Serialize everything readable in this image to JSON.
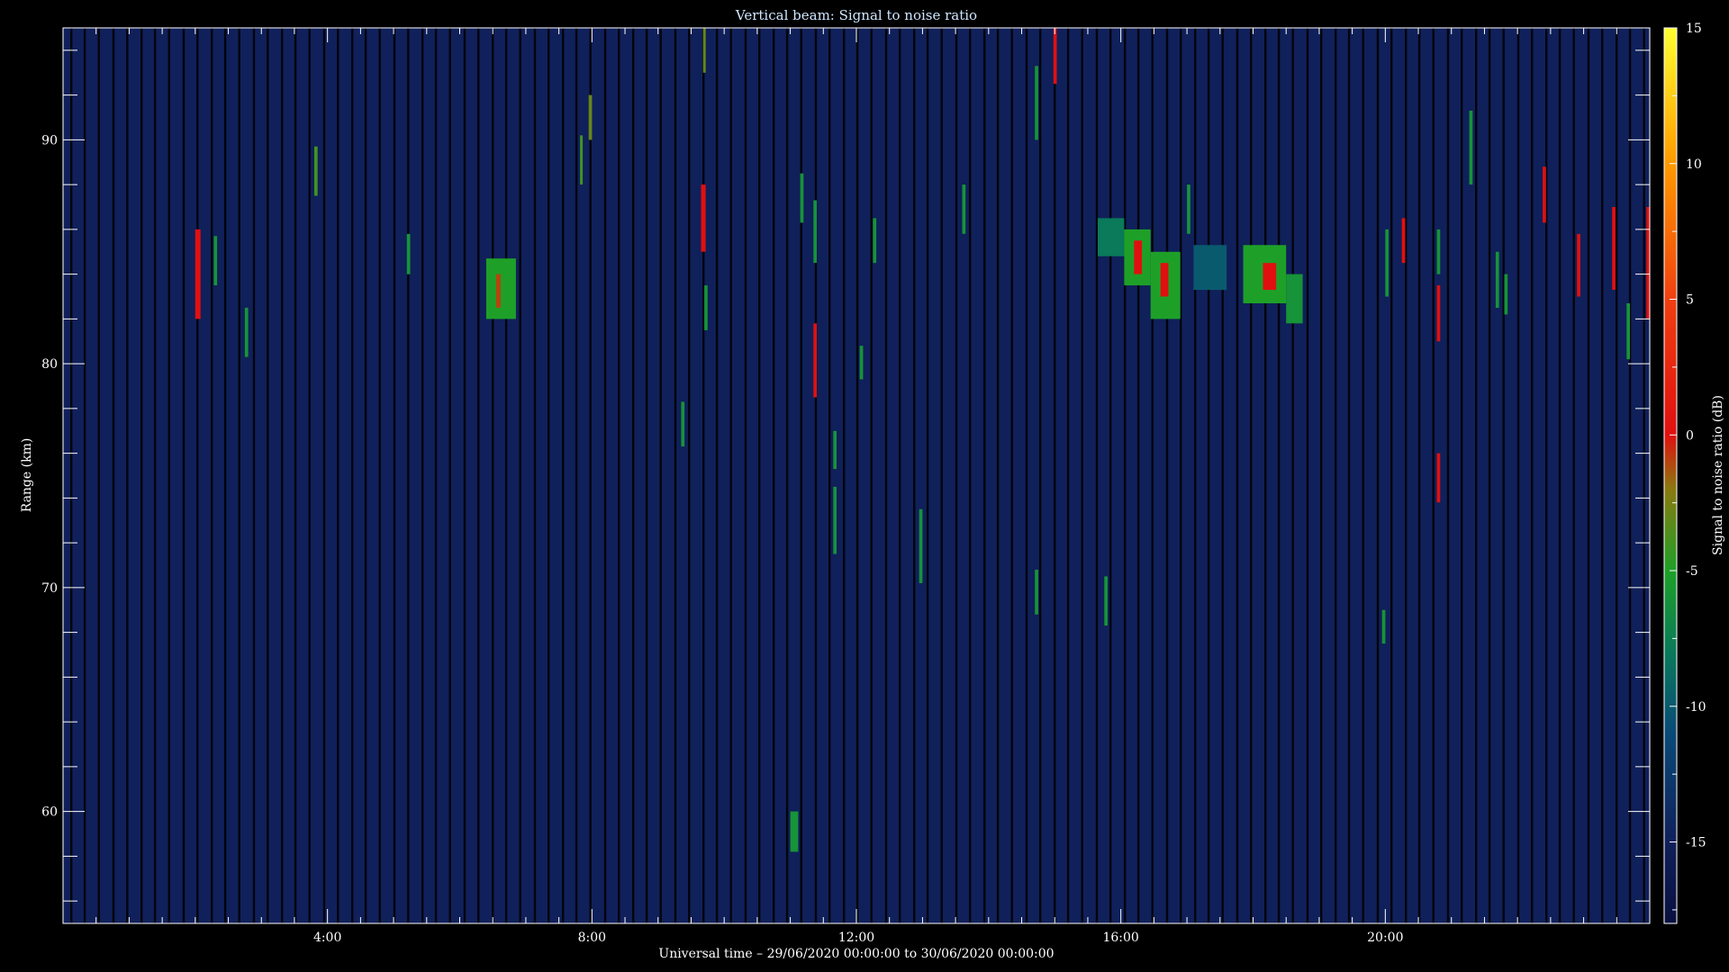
{
  "chart_data": {
    "type": "heatmap",
    "title": "Vertical beam: Signal to noise ratio",
    "xlabel": "Universal time – 29/06/2020 00:00:00 to 30/06/2020 00:00:00",
    "ylabel": "Range (km)",
    "colorbar_label": "Signal to noise ratio (dB)",
    "xlim_hours": [
      0,
      24
    ],
    "ylim_km": [
      55,
      95
    ],
    "x_ticks": [
      {
        "hour": 4,
        "label": "4:00"
      },
      {
        "hour": 8,
        "label": "8:00"
      },
      {
        "hour": 12,
        "label": "12:00"
      },
      {
        "hour": 16,
        "label": "16:00"
      },
      {
        "hour": 20,
        "label": "20:00"
      }
    ],
    "y_ticks": [
      {
        "km": 60,
        "label": "60"
      },
      {
        "km": 70,
        "label": "70"
      },
      {
        "km": 80,
        "label": "80"
      },
      {
        "km": 90,
        "label": "90"
      }
    ],
    "colorbar_range_db": [
      -18,
      15
    ],
    "colorbar_ticks": [
      {
        "db": 15,
        "label": "15"
      },
      {
        "db": 10,
        "label": "10"
      },
      {
        "db": 5,
        "label": "5"
      },
      {
        "db": 0,
        "label": "0"
      },
      {
        "db": -5,
        "label": "-5"
      },
      {
        "db": -10,
        "label": "-10"
      },
      {
        "db": -15,
        "label": "-15"
      }
    ],
    "background_snr_db": -15,
    "colors": {
      "background": "#000000",
      "plot_background": "#10205a",
      "axis": "#ffffff",
      "title": "#cfe6ff"
    },
    "colormap": [
      {
        "db": -18,
        "color": "#0a1040"
      },
      {
        "db": -15,
        "color": "#10205a"
      },
      {
        "db": -11,
        "color": "#0a4a78"
      },
      {
        "db": -8,
        "color": "#0a7a5a"
      },
      {
        "db": -5,
        "color": "#1ea028"
      },
      {
        "db": -2,
        "color": "#8a7a10"
      },
      {
        "db": 0,
        "color": "#e01010"
      },
      {
        "db": 5,
        "color": "#f04010"
      },
      {
        "db": 10,
        "color": "#ff9a00"
      },
      {
        "db": 15,
        "color": "#ffff30"
      }
    ],
    "echoes": [
      {
        "t_start": 2.0,
        "t_end": 2.08,
        "r_low": 82.0,
        "r_high": 86.0,
        "snr_db": 0
      },
      {
        "t_start": 2.28,
        "t_end": 2.33,
        "r_low": 83.5,
        "r_high": 85.7,
        "snr_db": -6
      },
      {
        "t_start": 2.75,
        "t_end": 2.8,
        "r_low": 80.3,
        "r_high": 82.5,
        "snr_db": -6
      },
      {
        "t_start": 3.8,
        "t_end": 3.85,
        "r_low": 87.5,
        "r_high": 89.7,
        "snr_db": -4
      },
      {
        "t_start": 5.2,
        "t_end": 5.25,
        "r_low": 84.0,
        "r_high": 85.8,
        "snr_db": -6
      },
      {
        "t_start": 6.4,
        "t_end": 6.85,
        "r_low": 82.0,
        "r_high": 84.7,
        "snr_db": -5
      },
      {
        "t_start": 6.55,
        "t_end": 6.62,
        "r_low": 82.5,
        "r_high": 84.0,
        "snr_db": -1
      },
      {
        "t_start": 7.82,
        "t_end": 7.86,
        "r_low": 88.0,
        "r_high": 90.2,
        "snr_db": -4
      },
      {
        "t_start": 7.95,
        "t_end": 8.0,
        "r_low": 90.0,
        "r_high": 92.0,
        "snr_db": -3
      },
      {
        "t_start": 9.35,
        "t_end": 9.4,
        "r_low": 76.3,
        "r_high": 78.3,
        "snr_db": -6
      },
      {
        "t_start": 9.65,
        "t_end": 9.72,
        "r_low": 85.0,
        "r_high": 88.0,
        "snr_db": 0
      },
      {
        "t_start": 9.68,
        "t_end": 9.72,
        "r_low": 93.0,
        "r_high": 95.0,
        "snr_db": -3
      },
      {
        "t_start": 9.7,
        "t_end": 9.75,
        "r_low": 81.5,
        "r_high": 83.5,
        "snr_db": -6
      },
      {
        "t_start": 11.0,
        "t_end": 11.12,
        "r_low": 58.2,
        "r_high": 60.0,
        "snr_db": -6
      },
      {
        "t_start": 11.15,
        "t_end": 11.2,
        "r_low": 86.3,
        "r_high": 88.5,
        "snr_db": -6
      },
      {
        "t_start": 11.35,
        "t_end": 11.4,
        "r_low": 78.5,
        "r_high": 81.8,
        "snr_db": 0
      },
      {
        "t_start": 11.35,
        "t_end": 11.4,
        "r_low": 84.5,
        "r_high": 87.3,
        "snr_db": -6
      },
      {
        "t_start": 11.65,
        "t_end": 11.7,
        "r_low": 71.5,
        "r_high": 74.5,
        "snr_db": -6
      },
      {
        "t_start": 11.65,
        "t_end": 11.7,
        "r_low": 75.3,
        "r_high": 77.0,
        "snr_db": -6
      },
      {
        "t_start": 12.05,
        "t_end": 12.1,
        "r_low": 79.3,
        "r_high": 80.8,
        "snr_db": -6
      },
      {
        "t_start": 12.25,
        "t_end": 12.3,
        "r_low": 84.5,
        "r_high": 86.5,
        "snr_db": -6
      },
      {
        "t_start": 12.95,
        "t_end": 13.0,
        "r_low": 70.2,
        "r_high": 73.5,
        "snr_db": -6
      },
      {
        "t_start": 13.6,
        "t_end": 13.65,
        "r_low": 85.8,
        "r_high": 88.0,
        "snr_db": -6
      },
      {
        "t_start": 14.7,
        "t_end": 14.75,
        "r_low": 90.0,
        "r_high": 93.3,
        "snr_db": -6
      },
      {
        "t_start": 14.7,
        "t_end": 14.75,
        "r_low": 68.8,
        "r_high": 70.8,
        "snr_db": -6
      },
      {
        "t_start": 14.98,
        "t_end": 15.03,
        "r_low": 92.5,
        "r_high": 95.0,
        "snr_db": 0
      },
      {
        "t_start": 15.75,
        "t_end": 15.8,
        "r_low": 68.3,
        "r_high": 70.5,
        "snr_db": -6
      },
      {
        "t_start": 15.65,
        "t_end": 16.05,
        "r_low": 84.8,
        "r_high": 86.5,
        "snr_db": -8
      },
      {
        "t_start": 16.05,
        "t_end": 16.45,
        "r_low": 83.5,
        "r_high": 86.0,
        "snr_db": -5
      },
      {
        "t_start": 16.2,
        "t_end": 16.32,
        "r_low": 84.0,
        "r_high": 85.5,
        "snr_db": 0
      },
      {
        "t_start": 16.45,
        "t_end": 16.9,
        "r_low": 82.0,
        "r_high": 85.0,
        "snr_db": -5
      },
      {
        "t_start": 16.6,
        "t_end": 16.72,
        "r_low": 83.0,
        "r_high": 84.5,
        "snr_db": 0
      },
      {
        "t_start": 17.0,
        "t_end": 17.05,
        "r_low": 85.8,
        "r_high": 88.0,
        "snr_db": -6
      },
      {
        "t_start": 17.1,
        "t_end": 17.6,
        "r_low": 83.3,
        "r_high": 85.3,
        "snr_db": -10
      },
      {
        "t_start": 17.85,
        "t_end": 18.5,
        "r_low": 82.7,
        "r_high": 85.3,
        "snr_db": -5
      },
      {
        "t_start": 18.15,
        "t_end": 18.35,
        "r_low": 83.3,
        "r_high": 84.5,
        "snr_db": 0
      },
      {
        "t_start": 18.5,
        "t_end": 18.75,
        "r_low": 81.8,
        "r_high": 84.0,
        "snr_db": -6
      },
      {
        "t_start": 19.95,
        "t_end": 20.0,
        "r_low": 67.5,
        "r_high": 69.0,
        "snr_db": -6
      },
      {
        "t_start": 20.0,
        "t_end": 20.05,
        "r_low": 83.0,
        "r_high": 86.0,
        "snr_db": -6
      },
      {
        "t_start": 20.25,
        "t_end": 20.3,
        "r_low": 84.5,
        "r_high": 86.5,
        "snr_db": 0
      },
      {
        "t_start": 20.78,
        "t_end": 20.83,
        "r_low": 81.0,
        "r_high": 83.5,
        "snr_db": 0
      },
      {
        "t_start": 20.78,
        "t_end": 20.83,
        "r_low": 84.0,
        "r_high": 86.0,
        "snr_db": -6
      },
      {
        "t_start": 20.78,
        "t_end": 20.83,
        "r_low": 73.8,
        "r_high": 76.0,
        "snr_db": 0
      },
      {
        "t_start": 21.27,
        "t_end": 21.32,
        "r_low": 88.0,
        "r_high": 91.3,
        "snr_db": -6
      },
      {
        "t_start": 21.67,
        "t_end": 21.72,
        "r_low": 82.5,
        "r_high": 85.0,
        "snr_db": -6
      },
      {
        "t_start": 21.8,
        "t_end": 21.85,
        "r_low": 82.2,
        "r_high": 84.0,
        "snr_db": -6
      },
      {
        "t_start": 22.38,
        "t_end": 22.43,
        "r_low": 86.3,
        "r_high": 88.8,
        "snr_db": 0
      },
      {
        "t_start": 22.9,
        "t_end": 22.95,
        "r_low": 83.0,
        "r_high": 85.8,
        "snr_db": 0
      },
      {
        "t_start": 23.43,
        "t_end": 23.48,
        "r_low": 83.3,
        "r_high": 87.0,
        "snr_db": 0
      },
      {
        "t_start": 23.65,
        "t_end": 23.7,
        "r_low": 80.2,
        "r_high": 82.7,
        "snr_db": -6
      },
      {
        "t_start": 23.95,
        "t_end": 24.0,
        "r_low": 82.0,
        "r_high": 87.0,
        "snr_db": 0
      }
    ]
  }
}
